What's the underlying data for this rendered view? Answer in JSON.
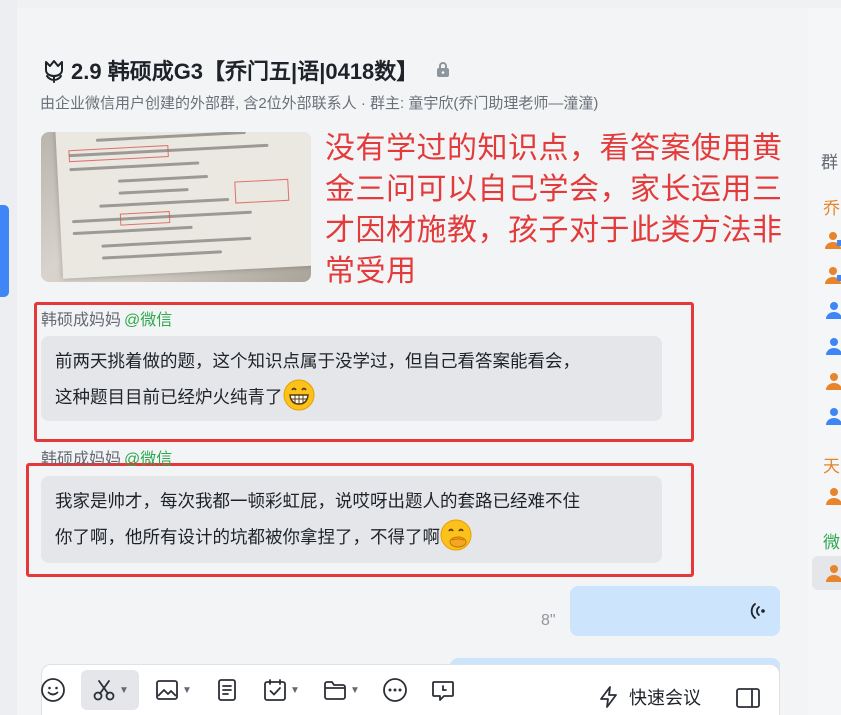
{
  "header": {
    "title": "2.9 韩硕成G3【乔门五|语|0418数】",
    "subtitle": "由企业微信用户创建的外部群, 含2位外部联系人 · 群主: 童宇欣(乔门助理老师—潼潼)"
  },
  "chat": {
    "caption": "没有学过的知识点，看答案使用黄金三问可以自己学会，家长运用三才因材施教，孩子对于此类方法非常受用",
    "messages": [
      {
        "sender": "韩硕成妈妈",
        "source": "@微信",
        "lines": [
          "前两天挑着做的题，这个知识点属于没学过，但自己看答案能看会，",
          "这种题目目前已经炉火纯青了"
        ],
        "emoji": "grinning-face"
      },
      {
        "sender": "韩硕成妈妈",
        "source": "@微信",
        "lines": [
          "我家是帅才，每次我都一顿彩虹屁，说哎呀出题人的套路已经难不住",
          "你了啊，他所有设计的坑都被你拿捏了，不得了啊"
        ],
        "emoji": "face-with-hand-over-mouth"
      }
    ],
    "voice": {
      "duration": "8\""
    }
  },
  "toolbar": {
    "quick_meeting": "快速会议"
  },
  "sidebar": {
    "group_label": "群",
    "sections": [
      {
        "label": "乔",
        "color": "#e8842b"
      },
      {
        "label": "天",
        "color": "#e8842b"
      },
      {
        "label": "微",
        "color": "#2ea84d"
      }
    ]
  },
  "colors": {
    "accent": "#3e86f5",
    "highlight_red": "#e5383b",
    "wechat_green": "#2ea84d",
    "voice_bubble": "#cce4fc"
  }
}
